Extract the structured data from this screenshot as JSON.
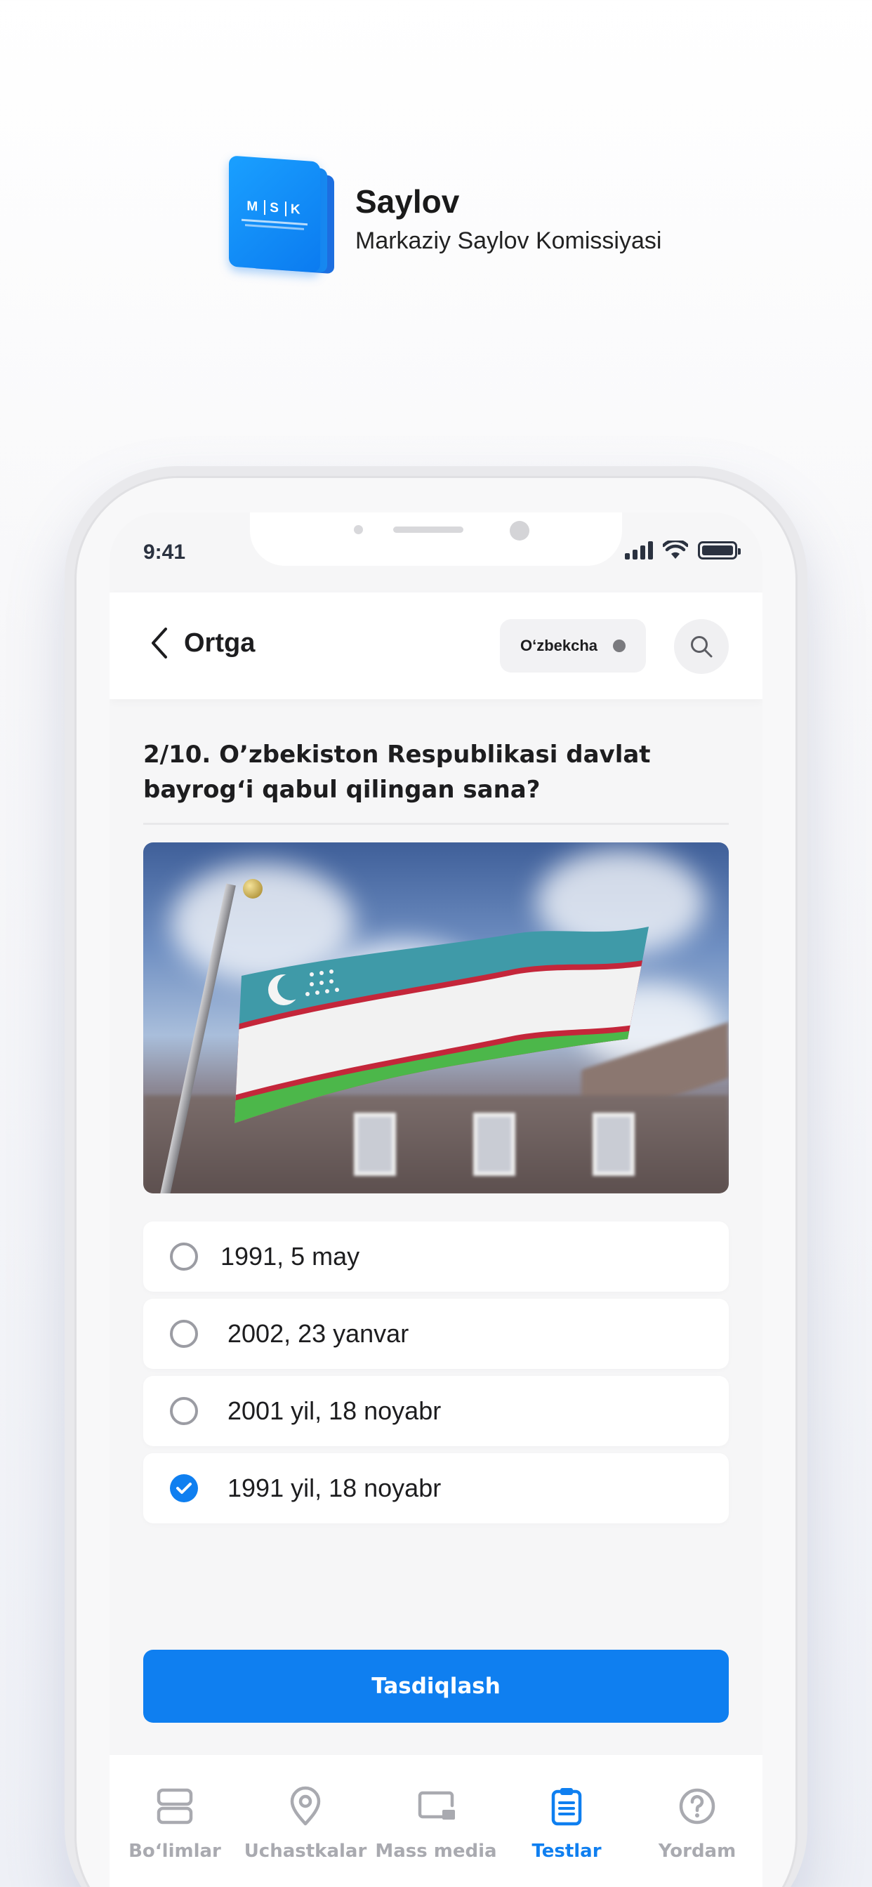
{
  "brand": {
    "title": "Saylov",
    "subtitle": "Markaziy Saylov Komissiyasi",
    "logo_letters": [
      "M",
      "S",
      "K"
    ]
  },
  "status_bar": {
    "time": "9:41"
  },
  "header": {
    "back_label": "Ortga",
    "language": "O‘zbekcha"
  },
  "question": {
    "text": "2/10. O’zbekiston Respublikasi davlat bayrog‘i qabul qilingan sana?"
  },
  "options": [
    {
      "label": "1991, 5 may",
      "selected": false
    },
    {
      "label": "2002, 23 yanvar",
      "selected": false
    },
    {
      "label": "2001 yil, 18 noyabr",
      "selected": false
    },
    {
      "label": "1991 yil, 18 noyabr",
      "selected": true
    }
  ],
  "confirm_label": "Tasdiqlash",
  "tabs": [
    {
      "label": "Bo‘limlar",
      "icon": "sections-icon",
      "active": false
    },
    {
      "label": "Uchastkalar",
      "icon": "location-pin-icon",
      "active": false
    },
    {
      "label": "Mass media",
      "icon": "media-icon",
      "active": false
    },
    {
      "label": "Testlar",
      "icon": "clipboard-icon",
      "active": true
    },
    {
      "label": "Yordam",
      "icon": "help-icon",
      "active": false
    }
  ],
  "colors": {
    "accent": "#0F7FF0",
    "inactive_tab": "#A9AAB0",
    "text": "#1D1D1F"
  }
}
